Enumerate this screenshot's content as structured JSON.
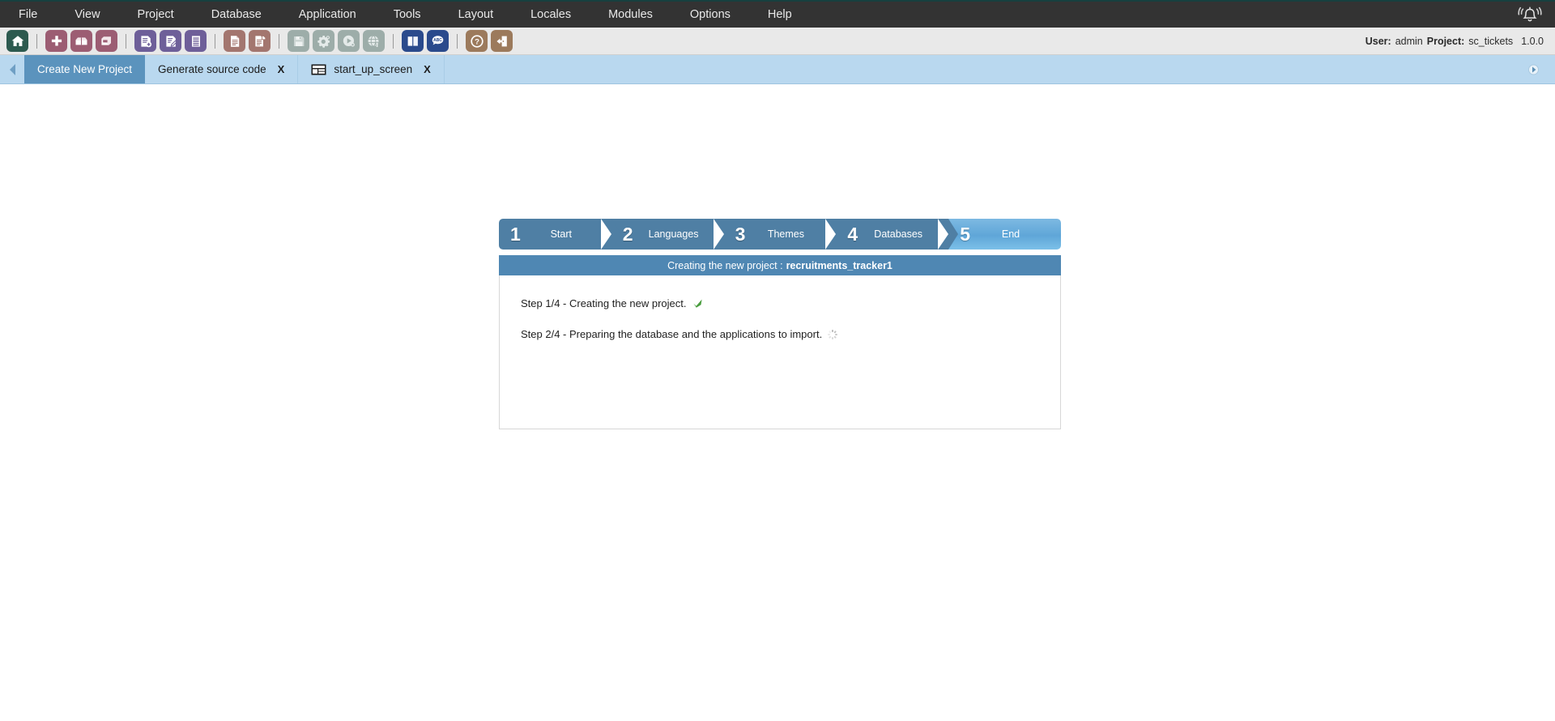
{
  "menubar": {
    "items": [
      {
        "label": "File",
        "name": "menu-file"
      },
      {
        "label": "View",
        "name": "menu-view"
      },
      {
        "label": "Project",
        "name": "menu-project"
      },
      {
        "label": "Database",
        "name": "menu-database"
      },
      {
        "label": "Application",
        "name": "menu-application"
      },
      {
        "label": "Tools",
        "name": "menu-tools"
      },
      {
        "label": "Layout",
        "name": "menu-layout"
      },
      {
        "label": "Locales",
        "name": "menu-locales"
      },
      {
        "label": "Modules",
        "name": "menu-modules"
      },
      {
        "label": "Options",
        "name": "menu-options"
      },
      {
        "label": "Help",
        "name": "menu-help"
      }
    ],
    "notification_icon": "bell-icon",
    "background": "#333333"
  },
  "toolbar": {
    "groups": [
      [
        {
          "icon": "home-icon",
          "color": "#2d5a4f"
        }
      ],
      [
        {
          "icon": "new-project-plus-icon",
          "color": "#9c5d73"
        },
        {
          "icon": "open-project-box-icon",
          "color": "#9c5d73"
        },
        {
          "icon": "close-project-box-icon",
          "color": "#9c5d73"
        }
      ],
      [
        {
          "icon": "new-application-icon",
          "color": "#6e5f99"
        },
        {
          "icon": "edit-application-icon",
          "color": "#6e5f99"
        },
        {
          "icon": "application-list-icon",
          "color": "#6e5f99"
        }
      ],
      [
        {
          "icon": "new-document-icon",
          "color": "#a3766f"
        },
        {
          "icon": "copy-document-icon",
          "color": "#a3766f"
        }
      ],
      [
        {
          "icon": "save-icon",
          "color": "#9dada9",
          "disabled": true
        },
        {
          "icon": "settings-gear-icon",
          "color": "#9dada9",
          "disabled": true
        },
        {
          "icon": "run-icon",
          "color": "#9dada9",
          "disabled": true
        },
        {
          "icon": "publish-globe-icon",
          "color": "#9dada9",
          "disabled": true
        }
      ],
      [
        {
          "icon": "manual-book-icon",
          "color": "#2a4a8c"
        },
        {
          "icon": "abc-spellcheck-icon",
          "color": "#2a4a8c"
        }
      ],
      [
        {
          "icon": "help-question-icon",
          "color": "#9c7a5c"
        },
        {
          "icon": "exit-door-icon",
          "color": "#9c7a5c"
        }
      ]
    ],
    "user_label": "User:",
    "user_value": "admin",
    "project_label": "Project:",
    "project_value": "sc_tickets",
    "version": "1.0.0"
  },
  "tabbar": {
    "scroll_left_icon": "chevron-left-icon",
    "scroll_right_icon": "chevron-right-icon",
    "tabs": [
      {
        "label": "Create New Project",
        "active": true,
        "closable": false,
        "icon": null,
        "name": "tab-create-new-project"
      },
      {
        "label": "Generate source code",
        "active": false,
        "closable": true,
        "close_label": "X",
        "icon": null,
        "name": "tab-generate-source-code"
      },
      {
        "label": "start_up_screen",
        "active": false,
        "closable": true,
        "close_label": "X",
        "icon": "form-layout-icon",
        "name": "tab-start-up-screen"
      }
    ]
  },
  "wizard": {
    "steps": [
      {
        "number": "1",
        "label": "Start",
        "current": false
      },
      {
        "number": "2",
        "label": "Languages",
        "current": false
      },
      {
        "number": "3",
        "label": "Themes",
        "current": false
      },
      {
        "number": "4",
        "label": "Databases",
        "current": false
      },
      {
        "number": "5",
        "label": "End",
        "current": true
      }
    ],
    "panel": {
      "header_prefix": "Creating the new project :",
      "header_project": "recruitments_tracker1",
      "progress": [
        {
          "text": "Step 1/4 - Creating the new project.",
          "status": "done",
          "status_icon": "green-check-icon"
        },
        {
          "text": "Step 2/4 - Preparing the database and the applications to import.",
          "status": "loading",
          "status_icon": "spinner-icon"
        }
      ]
    }
  },
  "colors": {
    "accent_blue": "#4f87b3",
    "step_blue": "#4f7fa4",
    "step_active_blue": "#6fb2de",
    "tabbar_blue": "#b9d8ef",
    "active_tab_blue": "#5b93bd",
    "menubar_dark": "#333333",
    "toolbar_gray": "#e9e9e9",
    "check_green": "#4a9d3f"
  }
}
